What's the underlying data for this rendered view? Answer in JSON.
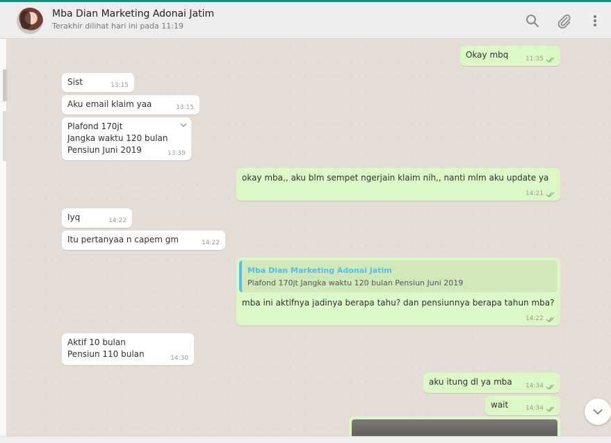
{
  "header": {
    "contact_name": "Mba Dian Marketing Adonai Jatim",
    "last_seen": "Terakhir dilihat hari ini pada 11:19",
    "icons": [
      "search-icon",
      "attach-icon",
      "menu-icon"
    ]
  },
  "colors": {
    "accent": "#009688",
    "incoming_bubble": "#ffffff",
    "outgoing_bubble": "#dcf8c6",
    "quote_bar": "#53bdeb",
    "chat_background": "#e5ddd5"
  },
  "messages": [
    {
      "direction": "out",
      "text": "Okay mbq",
      "time": "11:35"
    },
    {
      "direction": "in",
      "text": "Sist",
      "time": "13:15"
    },
    {
      "direction": "in",
      "text": "Aku email klaim yaa",
      "time": "13:15"
    },
    {
      "direction": "in",
      "lines": [
        "Plafond 170jt",
        "Jangka waktu 120 bulan",
        "Pensiun Juni 2019"
      ],
      "time": "13:39"
    },
    {
      "direction": "out",
      "text": "okay mba,, aku blm sempet ngerjain klaim nih,, nanti mlm aku update ya",
      "time": "14:21"
    },
    {
      "direction": "in",
      "text": "Iyq",
      "time": "14:22"
    },
    {
      "direction": "in",
      "text": "Itu pertanyaa n capem gm",
      "time": "14:22"
    },
    {
      "direction": "out",
      "quote_name": "Mba Dian Marketing Adonai Jatim",
      "quote_text": "Plafond 170jt Jangka waktu 120 bulan Pensiun Juni 2019",
      "text": "mba ini aktifnya jadinya berapa tahu? dan pensiunnya berapa tahun mba?",
      "time": "14:22"
    },
    {
      "direction": "in",
      "lines": [
        "Aktif 10 bulan",
        "Pensiun 110 bulan"
      ],
      "time": "14:30"
    },
    {
      "direction": "out",
      "text": "aku itung dl ya mba",
      "time": "14:34"
    },
    {
      "direction": "out",
      "text": "wait",
      "time": "14:34"
    },
    {
      "direction": "out",
      "type": "image"
    }
  ]
}
